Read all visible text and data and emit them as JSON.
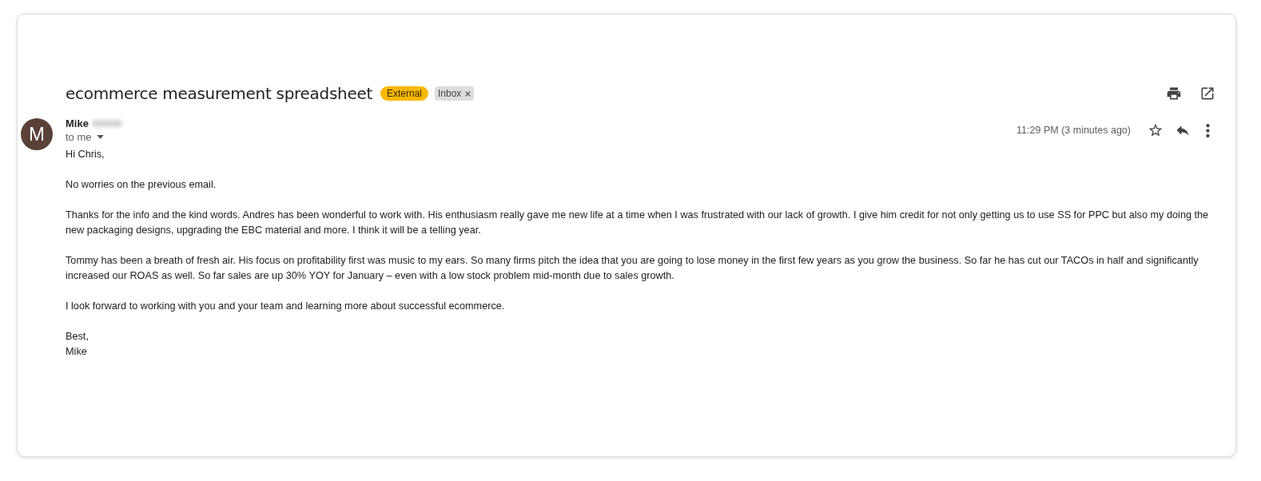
{
  "subject": "ecommerce measurement spreadsheet",
  "labels": [
    {
      "text": "External",
      "kind": "warning",
      "removable": false
    },
    {
      "text": "Inbox",
      "kind": "plain",
      "removable": true
    }
  ],
  "sender": {
    "initial": "M",
    "name": "Mike",
    "name_redacted": true,
    "recipient": "to me"
  },
  "time": "11:29 PM (3 minutes ago)",
  "starred": false,
  "body": [
    "Hi Chris,",
    "No worries on the previous email.",
    "Thanks for the info and the kind words. Andres has been wonderful to work with. His enthusiasm really gave me new life at a time when I was frustrated with our lack of growth. I give him credit for not only getting us to use SS for PPC but also my doing the new packaging designs, upgrading the EBC material and more. I think it will be a telling year.",
    "Tommy has been a breath of fresh air. His focus on profitability first was music to my ears. So many firms pitch the idea that you are going to lose money in the first few years as you grow the business. So far he has cut our TACOs in half and significantly increased our ROAS as well. So far sales are up 30% YOY for January – even with a low stock problem mid-month due to sales growth.",
    "I look forward to working with you and your team and learning more about successful ecommerce.",
    "Best,\nMike"
  ]
}
